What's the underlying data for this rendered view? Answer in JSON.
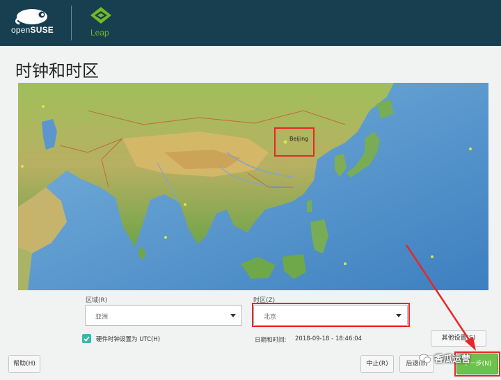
{
  "header": {
    "brand_light": "open",
    "brand_bold": "SUSE",
    "product": "Leap"
  },
  "page": {
    "title": "时钟和时区"
  },
  "map": {
    "city_label": "Beijing"
  },
  "region": {
    "label": "区域(R)",
    "value": "亚洲"
  },
  "timezone": {
    "label": "时区(Z)",
    "value": "北京"
  },
  "hwclock": {
    "label": "硬件时钟设置为 UTC(H)",
    "checked": true
  },
  "datetime": {
    "label": "日期和时间:",
    "value": "2018-09-18 - 18:46:04"
  },
  "buttons": {
    "other_settings": "其他设置(S)",
    "help": "帮助(H)",
    "abort": "中止(R)",
    "back": "后退(B)",
    "next": "下一步(N)"
  },
  "watermark": {
    "text": "香瓜运营"
  },
  "colors": {
    "header_bg": "#173f4f",
    "accent_green": "#73ba25",
    "annotation_red": "#e8262a"
  }
}
